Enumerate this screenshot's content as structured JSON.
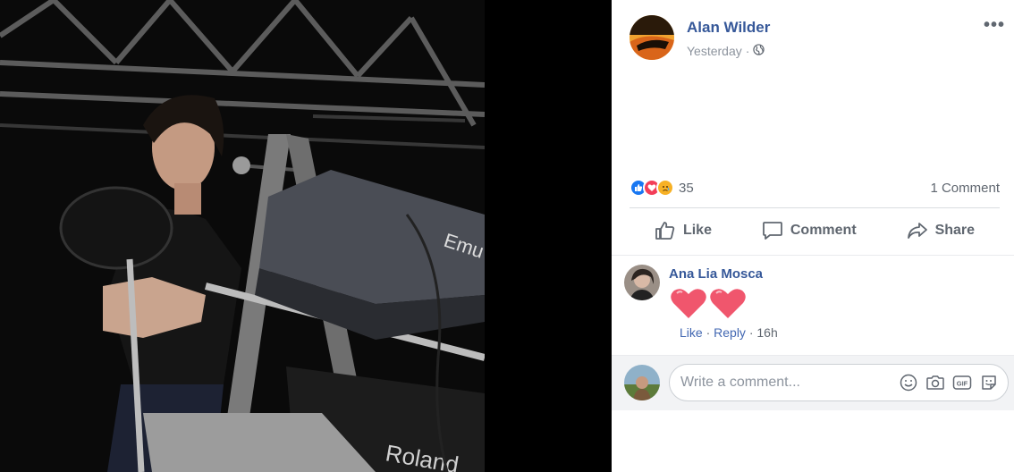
{
  "post": {
    "author": "Alan Wilder",
    "timestamp": "Yesterday",
    "audience_icon": "globe-icon",
    "more_label": "•••"
  },
  "reactions": {
    "types": [
      "like",
      "love",
      "sad"
    ],
    "count": "35",
    "comment_count": "1 Comment"
  },
  "actions": {
    "like": "Like",
    "comment": "Comment",
    "share": "Share"
  },
  "comment": {
    "author": "Ana Lia Mosca",
    "content_emoji": [
      "heart",
      "heart"
    ],
    "like_label": "Like",
    "sep1": " · ",
    "reply_label": "Reply",
    "sep2": " · ",
    "time": "16h"
  },
  "composer": {
    "placeholder": "Write a comment...",
    "icons": [
      "smiley-icon",
      "camera-icon",
      "gif-icon",
      "sticker-icon"
    ]
  },
  "colors": {
    "name_link": "#365899",
    "secondary_text": "#606770",
    "like_blue": "#1877f2",
    "love_red": "#f33e58",
    "heart_emoji": "#f0566d"
  }
}
